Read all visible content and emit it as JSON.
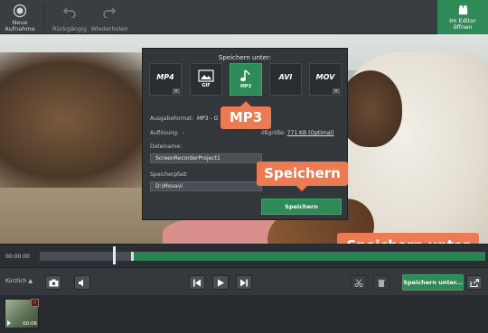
{
  "toolbar": {
    "new_recording_label": "Neue\nAufnahme",
    "undo_label": "Rückgängig",
    "redo_label": "Wiederholen",
    "open_editor_label": "Im Editor\nöffnen"
  },
  "dialog": {
    "title": "Speichern unter:",
    "formats": [
      {
        "name": "MP4",
        "sub": "",
        "selected": false,
        "more": true
      },
      {
        "name": "",
        "sub": "GIF",
        "selected": false,
        "more": false
      },
      {
        "name": "",
        "sub": "MP3",
        "selected": true,
        "more": false
      },
      {
        "name": "AVI",
        "sub": "",
        "selected": false,
        "more": false
      },
      {
        "name": "MOV",
        "sub": "",
        "selected": false,
        "more": true
      }
    ],
    "more_glyph": "»",
    "output_format_label": "Ausgabeformat:",
    "output_format_value": "MP3 - O",
    "resolution_label": "Auflösung:",
    "resolution_value": "-",
    "filesize_label": "ößgröße:",
    "filesize_value": "771 KB (Optimal)",
    "filename_label": "Dateiname:",
    "filename_value": "ScreenRecorderProject1",
    "path_label": "Speicherpfad:",
    "path_value": "D:\\Movavi",
    "save_button": "Speichern"
  },
  "callouts": {
    "mp3": "MP3",
    "save": "Speichern",
    "save_as": "Speichern unter"
  },
  "timeline": {
    "time": "00:00:00",
    "playhead_fraction": 0.164,
    "selection_start_fraction": 0.207
  },
  "controls": {
    "recent_label": "Kürzlich ▲",
    "save_as_button": "Speichern unter..."
  },
  "recents": {
    "items": [
      {
        "duration": "00:06",
        "close": "✕"
      }
    ]
  },
  "colors": {
    "accent_green": "#2e8a57",
    "callout_orange": "#ec7a52"
  }
}
